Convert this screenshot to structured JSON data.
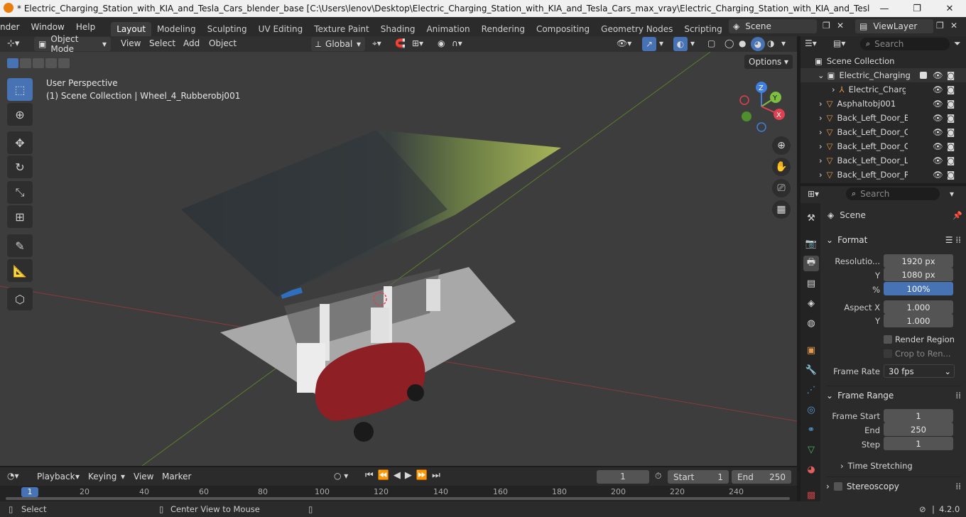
{
  "window": {
    "title": "* Electric_Charging_Station_with_KIA_and_Tesla_Cars_blender_base [C:\\Users\\lenov\\Desktop\\Electric_Charging_Station_with_KIA_and_Tesla_Cars_max_vray\\Electric_Charging_Station_with_KIA_and_Tesla_Cars_blender_base.blen...",
    "minimize": "—",
    "maximize": "❐",
    "close": "✕"
  },
  "menu": [
    "nder",
    "Window",
    "Help"
  ],
  "workspaces": [
    "Layout",
    "Modeling",
    "Sculpting",
    "UV Editing",
    "Texture Paint",
    "Shading",
    "Animation",
    "Rendering",
    "Compositing",
    "Geometry Nodes",
    "Scripting"
  ],
  "workspace_add": "+",
  "scene_name": "Scene",
  "view_layer": "ViewLayer",
  "viewport_header": {
    "mode": "Object Mode",
    "menus": [
      "View",
      "Select",
      "Add",
      "Object"
    ],
    "orientation": "Global",
    "options": "Options"
  },
  "viewport": {
    "perspective": "User Perspective",
    "context": "(1) Scene Collection | Wheel_4_Rubberobj001",
    "gizmo": {
      "x": "X",
      "y": "Y",
      "z": "Z"
    }
  },
  "outliner": {
    "search_placeholder": "Search",
    "rows": [
      {
        "name": "Scene Collection",
        "depth": 0
      },
      {
        "name": "Electric_Charging_S",
        "depth": 1
      },
      {
        "name": "Electric_Chargi",
        "depth": 2
      },
      {
        "name": "Asphaltobj001",
        "depth": 1
      },
      {
        "name": "Back_Left_Door_Bo",
        "depth": 1
      },
      {
        "name": "Back_Left_Door_Clc",
        "depth": 1
      },
      {
        "name": "Back_Left_Door_Clc",
        "depth": 1
      },
      {
        "name": "Back_Left_Door_Lig",
        "depth": 1
      },
      {
        "name": "Back_Left_Door_Pla",
        "depth": 1
      }
    ]
  },
  "properties": {
    "search_placeholder": "Search",
    "context": "Scene",
    "format": {
      "title": "Format",
      "resolution_x_label": "Resolutio...",
      "resolution_x": "1920 px",
      "resolution_y_label": "Y",
      "resolution_y": "1080 px",
      "percent_label": "%",
      "percent": "100%",
      "aspect_x_label": "Aspect X",
      "aspect_x": "1.000",
      "aspect_y_label": "Y",
      "aspect_y": "1.000",
      "render_region": "Render Region",
      "crop": "Crop to Ren...",
      "frame_rate_label": "Frame Rate",
      "frame_rate": "30 fps"
    },
    "frame_range": {
      "title": "Frame Range",
      "start_label": "Frame Start",
      "start": "1",
      "end_label": "End",
      "end": "250",
      "step_label": "Step",
      "step": "1"
    },
    "time_stretching": "Time Stretching",
    "stereoscopy": "Stereoscopy"
  },
  "timeline": {
    "menus": [
      "Playback",
      "Keying",
      "View",
      "Marker"
    ],
    "current_frame": "1",
    "start_label": "Start",
    "start": "1",
    "end_label": "End",
    "end": "250",
    "ruler": [
      "1",
      "20",
      "40",
      "60",
      "80",
      "100",
      "120",
      "140",
      "160",
      "180",
      "200",
      "220",
      "240"
    ]
  },
  "status": {
    "select": "Select",
    "center": "Center View to Mouse",
    "version": "4.2.0"
  },
  "colors": {
    "accent": "#4772b3",
    "x_axis": "#e04050",
    "y_axis": "#7fbf3f",
    "z_axis": "#3f7fe0"
  }
}
